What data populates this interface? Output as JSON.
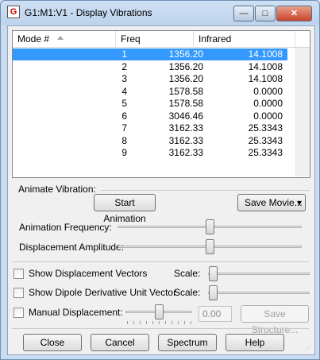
{
  "window": {
    "title": "G1:M1:V1 - Display Vibrations",
    "app_icon_glyph": "G",
    "minimize_glyph": "—",
    "maximize_glyph": "□",
    "close_glyph": "✕"
  },
  "table": {
    "columns": [
      "Mode #",
      "Freq",
      "Infrared"
    ],
    "rows": [
      {
        "mode": "1",
        "freq": "1356.20",
        "ir": "14.1008",
        "selected": true
      },
      {
        "mode": "2",
        "freq": "1356.20",
        "ir": "14.1008"
      },
      {
        "mode": "3",
        "freq": "1356.20",
        "ir": "14.1008"
      },
      {
        "mode": "4",
        "freq": "1578.58",
        "ir": "0.0000"
      },
      {
        "mode": "5",
        "freq": "1578.58",
        "ir": "0.0000"
      },
      {
        "mode": "6",
        "freq": "3046.46",
        "ir": "0.0000"
      },
      {
        "mode": "7",
        "freq": "3162.33",
        "ir": "25.3343"
      },
      {
        "mode": "8",
        "freq": "3162.33",
        "ir": "25.3343"
      },
      {
        "mode": "9",
        "freq": "3162.33",
        "ir": "25.3343"
      }
    ]
  },
  "animate": {
    "group_label": "Animate Vibration:",
    "start_button": "Start Animation",
    "save_movie_button": "Save Movie...",
    "dropdown_glyph": "▾",
    "frequency_label": "Animation Frequency:",
    "amplitude_label": "Displacement Amplitude:",
    "frequency_level": 0.5,
    "amplitude_level": 0.5
  },
  "options": {
    "show_vectors_label": "Show Displacement Vectors",
    "show_dipole_label": "Show Dipole Derivative Unit Vector",
    "manual_label": "Manual Displacement:",
    "scale_label": "Scale:",
    "manual_value": "0.00",
    "save_structure_button": "Save Structure...",
    "vectors_checked": false,
    "dipole_checked": false,
    "manual_checked": false
  },
  "footer": {
    "close_button": "Close",
    "cancel_button": "Cancel",
    "spectrum_button": "Spectrum",
    "help_button": "Help",
    "grip_glyph": "⋰"
  }
}
